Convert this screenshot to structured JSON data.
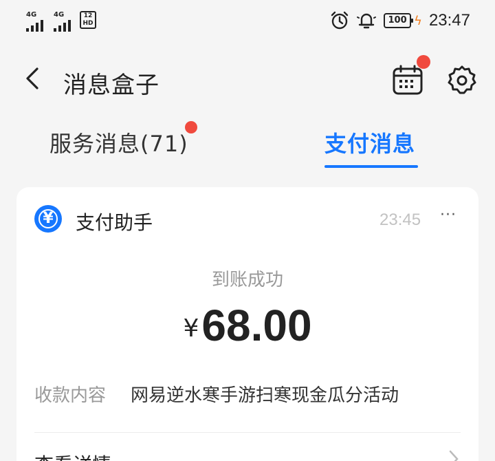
{
  "status_bar": {
    "network1": "4G",
    "network2": "4G",
    "hd_badge": "12\nHD",
    "battery": "100",
    "time": "23:47"
  },
  "header": {
    "title": "消息盒子"
  },
  "tabs": [
    {
      "label": "服务消息(71)",
      "active": false,
      "has_dot": true
    },
    {
      "label": "支付消息",
      "active": true
    }
  ],
  "message": {
    "sender": "支付助手",
    "logo_symbol": "¥",
    "time": "23:45",
    "more": "···",
    "subtitle": "到账成功",
    "currency": "¥",
    "amount": "68.00",
    "detail_label": "收款内容",
    "detail_value": "网易逆水寒手游扫寒现金瓜分活动",
    "view_details": "查看详情"
  },
  "colors": {
    "accent": "#1677ff",
    "badge": "#f04a3e",
    "background": "#f5f5f5"
  }
}
